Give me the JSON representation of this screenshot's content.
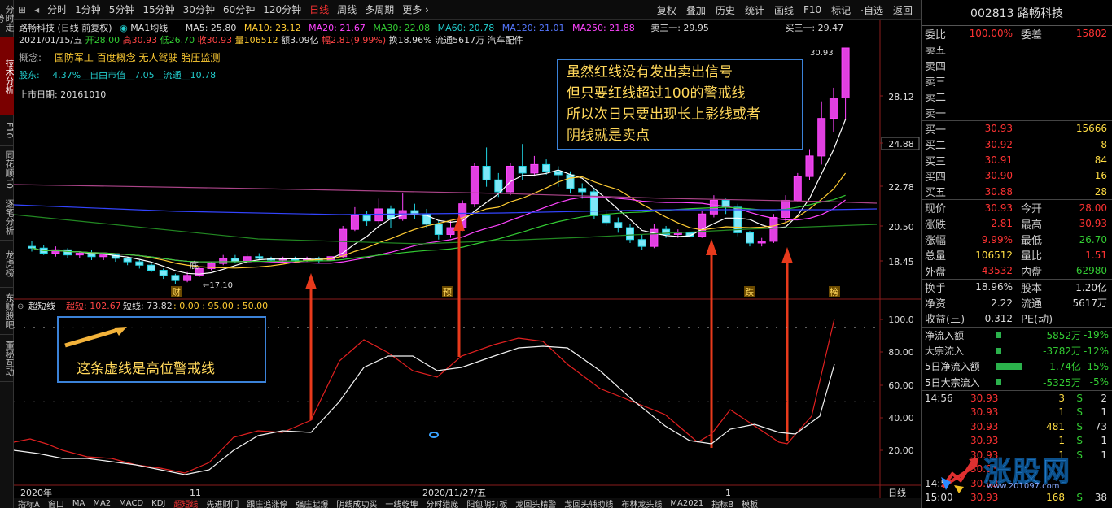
{
  "left_tabs": [
    {
      "label": "分时走势",
      "active": false
    },
    {
      "label": "技术分析",
      "active": true
    },
    {
      "label": "F10",
      "active": false
    },
    {
      "label": "同花顺10",
      "active": false
    },
    {
      "label": "逐笔分析",
      "active": false
    },
    {
      "label": "龙虎榜",
      "active": false
    },
    {
      "label": "东财股吧",
      "active": false
    },
    {
      "label": "董秘互动",
      "active": false
    }
  ],
  "toolbar": {
    "periods": [
      "分时",
      "1分钟",
      "5分钟",
      "15分钟",
      "30分钟",
      "60分钟",
      "120分钟",
      "日线",
      "周线",
      "多周期",
      "更多 ›"
    ],
    "active_period": "日线",
    "tools": [
      "复权",
      "叠加",
      "历史",
      "统计",
      "画线",
      "F10",
      "标记",
      "·自选",
      "返回"
    ]
  },
  "info": {
    "stock_line": "路畅科技 (日线 前复权)",
    "ma_label": "MA1均线",
    "ma5": "MA5: 25.80",
    "ma10": "MA10: 23.12",
    "ma20": "MA20: 21.67",
    "ma30": "MA30: 22.08",
    "ma60": "MA60: 20.78",
    "ma120": "MA120: 21.01",
    "ma250": "MA250: 21.88",
    "sell3": "卖三一: 29.95",
    "buy3": "买三一: 29.47",
    "date": "2021/01/15/五",
    "open": "开28.00",
    "high": "高30.93",
    "low": "低26.70",
    "close": "收30.93",
    "volume": "量106512",
    "amount": "额3.09亿",
    "amp": "幅2.81(9.99%)",
    "turnover": "换18.96%",
    "float": "流通5617万",
    "industry": "汽车配件",
    "concept_label": "概念:",
    "concepts": "国防军工  百度概念  无人驾驶  胎压监测",
    "holder_label": "股东:",
    "holder": "4.37%__自由市值__7.05__流通__10.78",
    "listing": "上市日期: 20161010"
  },
  "price_axis": [
    "28.12",
    "24.88",
    "22.78",
    "20.50",
    "18.45"
  ],
  "price_highlight": "24.88",
  "chart_marks": {
    "high_label": "30.93",
    "low_label": "17.10",
    "bottom_label": "底",
    "event_labels": [
      "财",
      "预",
      "跌",
      "榜"
    ]
  },
  "indicator": {
    "name": "超短线",
    "super_label": "超短: 102.67",
    "short_label": "短线: 73.82",
    "levels": ": 0.00 : 95.00 : 50.00",
    "axis": [
      "100.0",
      "80.00",
      "60.00",
      "40.00",
      "20.00"
    ]
  },
  "x_axis": {
    "left": "2020年",
    "mid1": "11",
    "mid2": "2020/11/27/五",
    "mid3": "1",
    "right": "日线"
  },
  "notes": {
    "top_lines": [
      "虽然红线没有发出卖出信号",
      "但只要红线超过100的警戒线",
      "所以次日只要出现长上影线或者",
      "阴线就是卖点"
    ],
    "bottom": "这条虚线是高位警戒线"
  },
  "bottom_tabs": [
    "指标A",
    "窗口",
    "MA",
    "MA2",
    "MACD",
    "KDJ",
    "超短线",
    "先进财门",
    "跟庄追涨停",
    "强庄起爆",
    "阴线成功买",
    "一线乾坤",
    "分时猎庞",
    "阳包阴打板",
    "龙回头精警",
    "龙回头辅助线",
    "布林龙头线",
    "MA2021",
    "指标B",
    "模板"
  ],
  "bottom_active": "超短线",
  "right_panel": {
    "code_name": "002813 路畅科技",
    "weibi_label": "委比",
    "weibi": "100.00%",
    "weicha_label": "委差",
    "weicha": "15802",
    "sells": [
      "卖五",
      "卖四",
      "卖三",
      "卖二",
      "卖一"
    ],
    "buys": [
      {
        "label": "买一",
        "price": "30.93",
        "vol": "15666"
      },
      {
        "label": "买二",
        "price": "30.92",
        "vol": "8"
      },
      {
        "label": "买三",
        "price": "30.91",
        "vol": "84"
      },
      {
        "label": "买四",
        "price": "30.90",
        "vol": "16"
      },
      {
        "label": "买五",
        "price": "30.88",
        "vol": "28"
      }
    ],
    "stats": [
      {
        "l1": "现价",
        "v1": "30.93",
        "c1": "#ff3333",
        "l2": "今开",
        "v2": "28.00",
        "c2": "#ff3333"
      },
      {
        "l1": "涨跌",
        "v1": "2.81",
        "c1": "#ff3333",
        "l2": "最高",
        "v2": "30.93",
        "c2": "#ff3333"
      },
      {
        "l1": "涨幅",
        "v1": "9.99%",
        "c1": "#ff3333",
        "l2": "最低",
        "v2": "26.70",
        "c2": "#33cc33"
      },
      {
        "l1": "总量",
        "v1": "106512",
        "c1": "#ffdd44",
        "l2": "量比",
        "v2": "1.51",
        "c2": "#ff3333"
      },
      {
        "l1": "外盘",
        "v1": "43532",
        "c1": "#ff3333",
        "l2": "内盘",
        "v2": "62980",
        "c2": "#33cc33"
      }
    ],
    "stats2": [
      {
        "l1": "换手",
        "v1": "18.96%",
        "c1": "#dddddd",
        "l2": "股本",
        "v2": "1.20亿",
        "c2": "#dddddd"
      },
      {
        "l1": "净资",
        "v1": "2.22",
        "c1": "#dddddd",
        "l2": "流通",
        "v2": "5617万",
        "c2": "#dddddd"
      },
      {
        "l1": "收益(三)",
        "v1": "-0.312",
        "c1": "#dddddd",
        "l2": "PE(动)",
        "v2": "",
        "c2": "#dddddd"
      }
    ],
    "flows": [
      {
        "label": "净流入额",
        "value": "-5852万",
        "pct": "-19%",
        "bar": 0.1
      },
      {
        "label": "大宗流入",
        "value": "-3782万",
        "pct": "-12%",
        "bar": 0.1
      },
      {
        "label": "5日净流入额",
        "value": "-1.74亿",
        "pct": "-15%",
        "bar": 1.0
      },
      {
        "label": "5日大宗流入",
        "value": "-5325万",
        "pct": "-5%",
        "bar": 0.15
      }
    ],
    "ticks": [
      {
        "time": "14:56",
        "price": "30.93",
        "vol": "3",
        "side": "S",
        "n": "2"
      },
      {
        "time": "",
        "price": "30.93",
        "vol": "1",
        "side": "S",
        "n": "1"
      },
      {
        "time": "",
        "price": "30.93",
        "vol": "481",
        "side": "S",
        "n": "73"
      },
      {
        "time": "",
        "price": "30.93",
        "vol": "1",
        "side": "S",
        "n": "1"
      },
      {
        "time": "",
        "price": "30.93",
        "vol": "1",
        "side": "S",
        "n": "1"
      },
      {
        "time": "",
        "price": "30.93",
        "vol": "",
        "side": "",
        "n": ""
      },
      {
        "time": "14:5",
        "price": "30.93",
        "vol": "",
        "side": "",
        "n": ""
      },
      {
        "time": "15:00",
        "price": "30.93",
        "vol": "168",
        "side": "S",
        "n": "38"
      }
    ],
    "watermark": "涨股网",
    "watermark_url": "www.201097.com"
  }
}
